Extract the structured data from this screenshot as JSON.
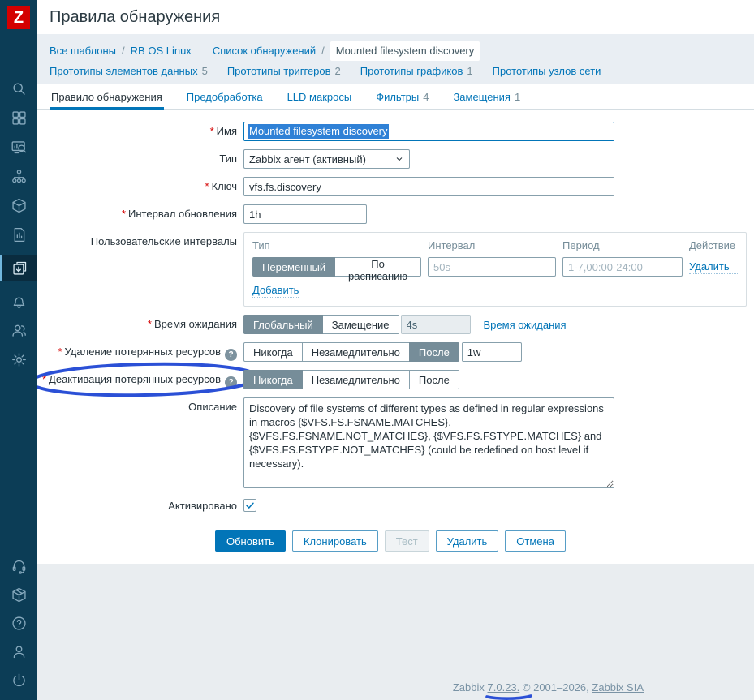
{
  "app": {
    "logo_letter": "Z"
  },
  "header": {
    "title": "Правила обнаружения"
  },
  "sidebar": {
    "items": [
      {
        "name": "search",
        "icon": "search-icon"
      },
      {
        "name": "dashboards",
        "icon": "dashboards-icon"
      },
      {
        "name": "monitoring",
        "icon": "monitoring-icon"
      },
      {
        "name": "services",
        "icon": "services-icon"
      },
      {
        "name": "inventory",
        "icon": "inventory-icon"
      },
      {
        "name": "reports",
        "icon": "reports-icon"
      },
      {
        "name": "data-collection",
        "icon": "data-collection-icon",
        "selected": true
      },
      {
        "name": "alerts",
        "icon": "bell-icon"
      },
      {
        "name": "users",
        "icon": "users-icon"
      },
      {
        "name": "administration",
        "icon": "gear-icon"
      },
      {
        "name": "support",
        "icon": "headset-icon"
      },
      {
        "name": "integrations",
        "icon": "cube-icon"
      },
      {
        "name": "help",
        "icon": "help-icon"
      },
      {
        "name": "user-profile",
        "icon": "user-icon"
      },
      {
        "name": "sign-out",
        "icon": "power-icon"
      }
    ]
  },
  "breadcrumb": {
    "separator": "/",
    "links": [
      "Все шаблоны",
      "RB OS Linux",
      "Список обнаружений"
    ],
    "current": "Mounted filesystem discovery",
    "sub_links": [
      {
        "label": "Прототипы элементов данных",
        "count": "5"
      },
      {
        "label": "Прототипы триггеров",
        "count": "2"
      },
      {
        "label": "Прототипы графиков",
        "count": "1"
      },
      {
        "label": "Прототипы узлов сети",
        "count": ""
      }
    ]
  },
  "tabs": [
    {
      "label": "Правило обнаружения",
      "count": ""
    },
    {
      "label": "Предобработка",
      "count": ""
    },
    {
      "label": "LLD макросы",
      "count": ""
    },
    {
      "label": "Фильтры",
      "count": "4"
    },
    {
      "label": "Замещения",
      "count": "1"
    }
  ],
  "ui": {
    "required_marker": "*",
    "help_glyph": "?"
  },
  "form": {
    "name": {
      "label": "Имя",
      "value": "Mounted filesystem discovery"
    },
    "type": {
      "label": "Тип",
      "value": "Zabbix агент (активный)"
    },
    "key": {
      "label": "Ключ",
      "value": "vfs.fs.discovery"
    },
    "update_interval": {
      "label": "Интервал обновления",
      "value": "1h"
    },
    "custom_intervals": {
      "label": "Пользовательские интервалы",
      "columns": [
        "Тип",
        "Интервал",
        "Период",
        "Действие"
      ],
      "row": {
        "type_options": [
          "Переменный",
          "По расписанию"
        ],
        "type_selected": "Переменный",
        "interval_placeholder": "50s",
        "period_placeholder": "1-7,00:00-24:00",
        "remove_label": "Удалить"
      },
      "add_label": "Добавить"
    },
    "timeout": {
      "label": "Время ожидания",
      "options": [
        "Глобальный",
        "Замещение"
      ],
      "selected": "Глобальный",
      "value": "4s",
      "link": "Время ожидания"
    },
    "delete_lost": {
      "label": "Удаление потерянных ресурсов",
      "options": [
        "Никогда",
        "Незамедлительно",
        "После"
      ],
      "selected": "После",
      "value": "1w"
    },
    "disable_lost": {
      "label": "Деактивация потерянных ресурсов",
      "options": [
        "Никогда",
        "Незамедлительно",
        "После"
      ],
      "selected": "Никогда"
    },
    "description": {
      "label": "Описание",
      "value": "Discovery of file systems of different types as defined in regular expressions in macros {$VFS.FS.FSNAME.MATCHES}, {$VFS.FS.FSNAME.NOT_MATCHES}, {$VFS.FS.FSTYPE.MATCHES} and {$VFS.FS.FSTYPE.NOT_MATCHES} (could be redefined on host level if necessary)."
    },
    "enabled": {
      "label": "Активировано",
      "checked": true
    }
  },
  "buttons": {
    "update": "Обновить",
    "clone": "Клонировать",
    "test": "Тест",
    "delete": "Удалить",
    "cancel": "Отмена"
  },
  "footer": {
    "prefix": "Zabbix",
    "version": "7.0.23.",
    "copyright": "© 2001–2026,",
    "company": "Zabbix SIA"
  },
  "annotations": {
    "marker_color": "#2b50d6"
  },
  "colors": {
    "accent_blue": "#0275b8",
    "sidebar_bg": "#0c3d56",
    "logo_red": "#d40000",
    "segment_active": "#768d99",
    "selection_blue": "#2f81d6",
    "breadcrumb_bg": "#e9eef3",
    "annotation_blue": "#2b50d6"
  }
}
